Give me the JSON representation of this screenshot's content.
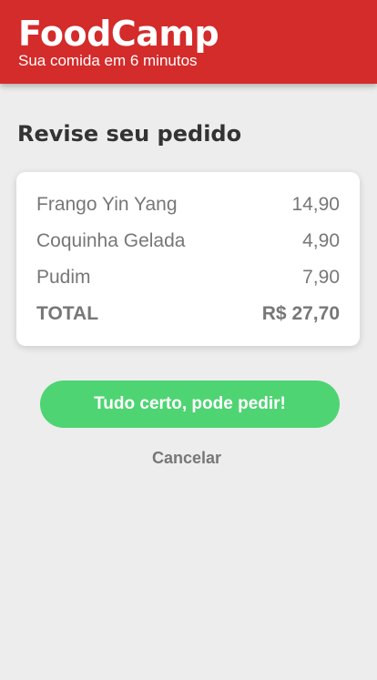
{
  "header": {
    "brand": "FoodCamp",
    "tagline": "Sua comida em 6 minutos",
    "background_color": "#d42b2b"
  },
  "main": {
    "title": "Revise seu pedido",
    "order": {
      "items": [
        {
          "name": "Frango Yin Yang",
          "price": "14,90"
        },
        {
          "name": "Coquinha Gelada",
          "price": "4,90"
        },
        {
          "name": "Pudim",
          "price": "7,90"
        }
      ],
      "total_label": "TOTAL",
      "total_value": "R$ 27,70"
    },
    "confirm_button": {
      "label": "Tudo certo, pode pedir!",
      "color": "#4fd473"
    },
    "cancel_label": "Cancelar"
  }
}
